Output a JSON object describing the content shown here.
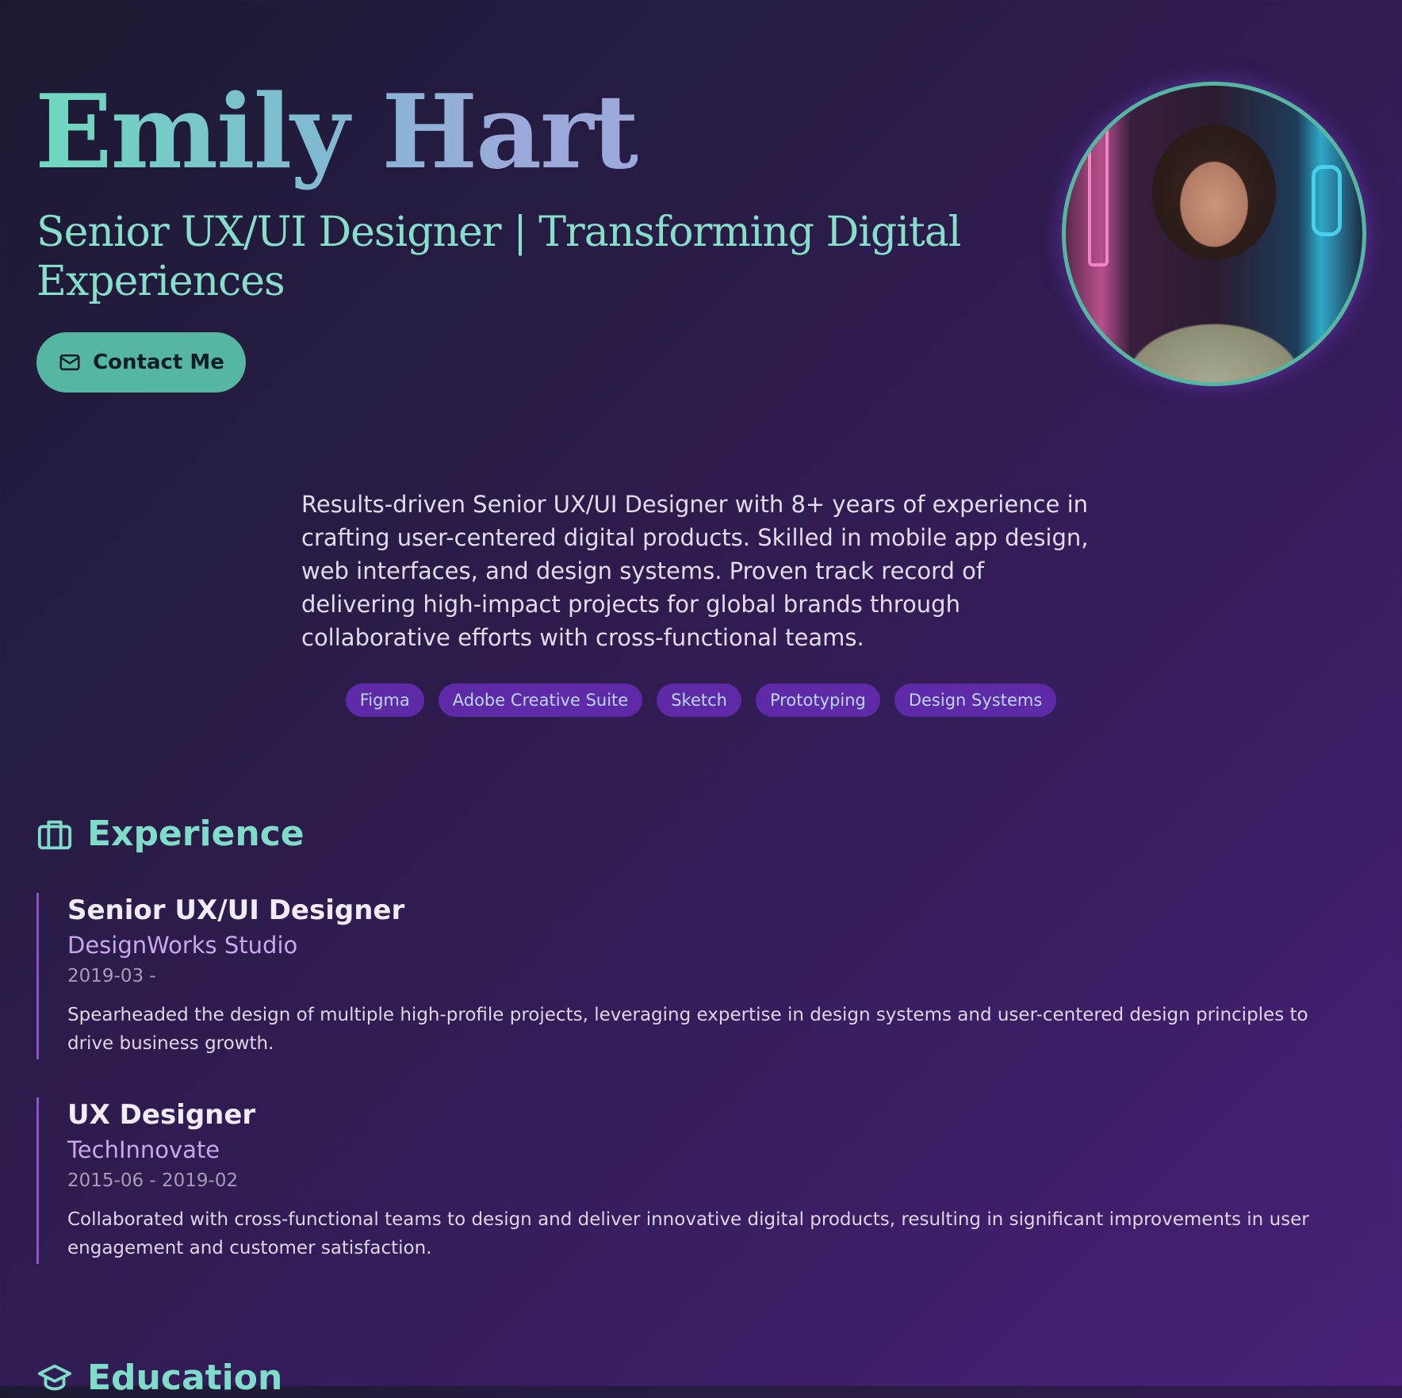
{
  "hero": {
    "name": "Emily Hart",
    "tagline": "Senior UX/UI Designer | Transforming Digital Experiences",
    "contact_label": "Contact Me",
    "contact_icon": "mail-icon",
    "avatar_alt": "profile-photo"
  },
  "summary": {
    "text": "Results-driven Senior UX/UI Designer with 8+ years of experience in crafting user-centered digital products. Skilled in mobile app design, web interfaces, and design systems. Proven track record of delivering high-impact projects for global brands through collaborative efforts with cross-functional teams.",
    "skills": [
      "Figma",
      "Adobe Creative Suite",
      "Sketch",
      "Prototyping",
      "Design Systems"
    ]
  },
  "experience": {
    "heading": "Experience",
    "icon": "briefcase-icon",
    "items": [
      {
        "title": "Senior UX/UI Designer",
        "company": "DesignWorks Studio",
        "dates": "2019-03 -",
        "description": "Spearheaded the design of multiple high-profile projects, leveraging expertise in design systems and user-centered design principles to drive business growth."
      },
      {
        "title": "UX Designer",
        "company": "TechInnovate",
        "dates": "2015-06 - 2019-02",
        "description": "Collaborated with cross-functional teams to design and deliver innovative digital products, resulting in significant improvements in user engagement and customer satisfaction."
      }
    ]
  },
  "education": {
    "heading": "Education",
    "icon": "graduation-cap-icon"
  },
  "colors": {
    "accent": "#55b7a1",
    "heading": "#7fdcc8",
    "skill_bg": "#5e2aa8",
    "company": "#c8a8ec"
  }
}
